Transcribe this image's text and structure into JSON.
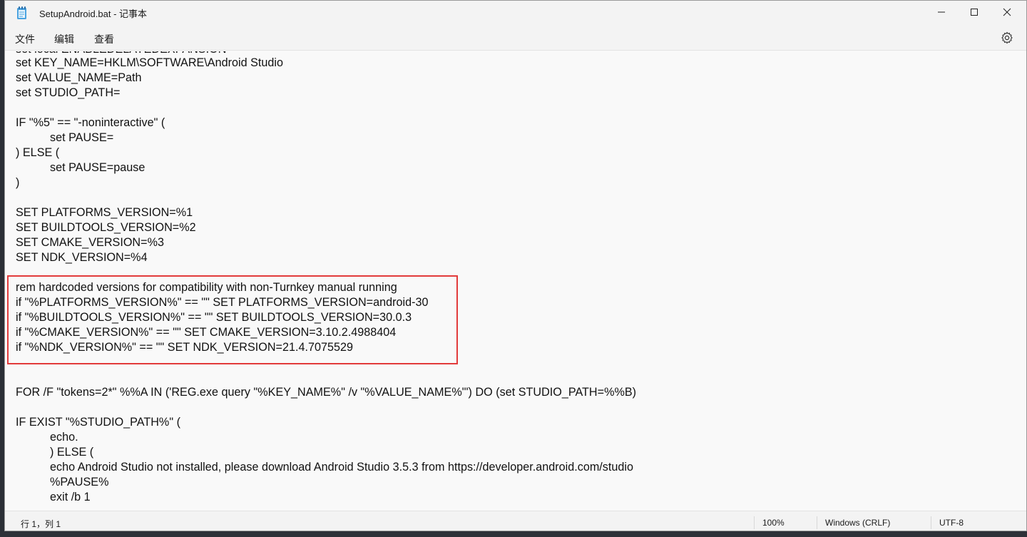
{
  "window": {
    "title": "SetupAndroid.bat - 记事本"
  },
  "menu": {
    "file": "文件",
    "edit": "编辑",
    "view": "查看"
  },
  "editor": {
    "cut_line": "set local ENABLEDELAYEDEXPANSION",
    "lines": [
      "set KEY_NAME=HKLM\\SOFTWARE\\Android Studio",
      "set VALUE_NAME=Path",
      "set STUDIO_PATH=",
      "",
      "IF \"%5\" == \"-noninteractive\" (",
      "set PAUSE=",
      ") ELSE (",
      "set PAUSE=pause",
      ")",
      "",
      "SET PLATFORMS_VERSION=%1",
      "SET BUILDTOOLS_VERSION=%2",
      "SET CMAKE_VERSION=%3",
      "SET NDK_VERSION=%4",
      "",
      "rem hardcoded versions for compatibility with non-Turnkey manual running",
      "if \"%PLATFORMS_VERSION%\" == \"\" SET PLATFORMS_VERSION=android-30",
      "if \"%BUILDTOOLS_VERSION%\" == \"\" SET BUILDTOOLS_VERSION=30.0.3",
      "if \"%CMAKE_VERSION%\" == \"\" SET CMAKE_VERSION=3.10.2.4988404",
      "if \"%NDK_VERSION%\" == \"\" SET NDK_VERSION=21.4.7075529",
      "",
      "",
      "FOR /F \"tokens=2*\" %%A IN ('REG.exe query \"%KEY_NAME%\" /v \"%VALUE_NAME%\"') DO (set STUDIO_PATH=%%B)",
      "",
      "IF EXIST \"%STUDIO_PATH%\" (",
      "echo.",
      ") ELSE (",
      "echo Android Studio not installed, please download Android Studio 3.5.3 from https://developer.android.com/studio",
      "%PAUSE%",
      "exit /b 1"
    ]
  },
  "status": {
    "position": "行 1，列 1",
    "zoom": "100%",
    "line_ending": "Windows (CRLF)",
    "encoding": "UTF-8"
  },
  "colors": {
    "highlight_border": "#e23b3b"
  }
}
